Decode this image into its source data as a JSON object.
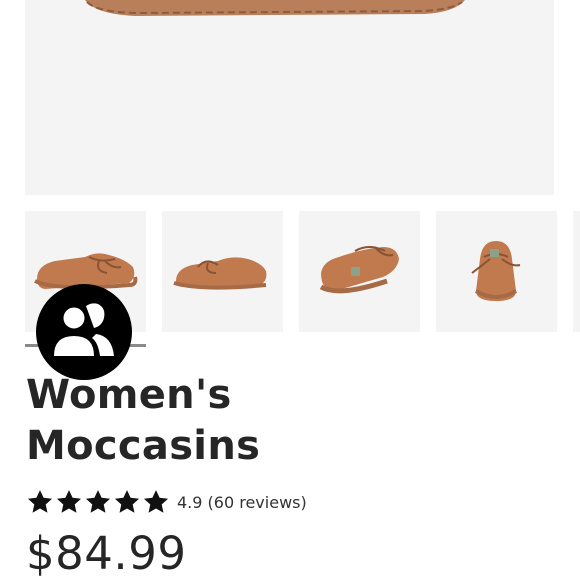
{
  "product": {
    "title_line1": "Women's",
    "title_line2": "Moccasins",
    "rating": "4.9",
    "stars": 5,
    "reviews": "(60 reviews)",
    "price": "$84.99"
  },
  "gallery": {
    "thumbnails": [
      {
        "view": "side-front"
      },
      {
        "view": "side"
      },
      {
        "view": "rear-three-quarter"
      },
      {
        "view": "front"
      }
    ],
    "selected_index": 0
  },
  "colors": {
    "shoe_suede": "#c07a4e",
    "shoe_sole": "#a76a47",
    "image_bg": "#f4f4f4",
    "star": "#111111"
  },
  "icons": {
    "chat": "users-chat-icon",
    "star": "star-icon"
  }
}
